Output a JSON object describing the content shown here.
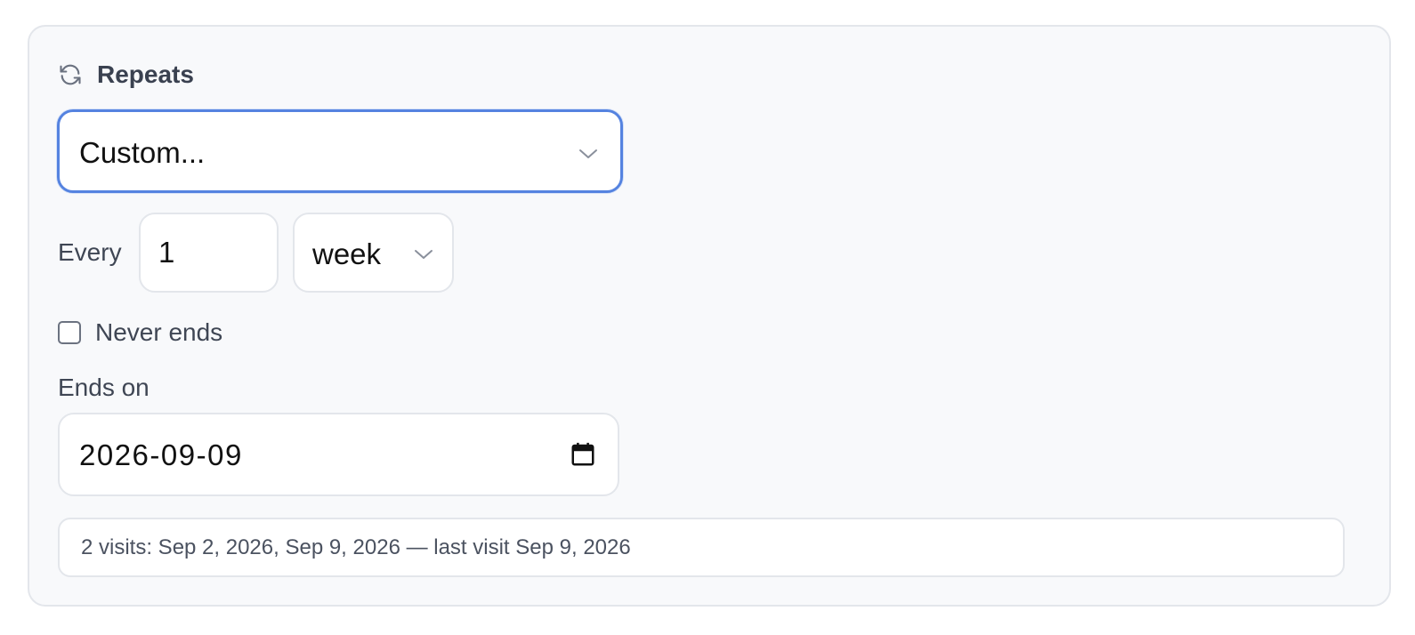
{
  "section": {
    "title": "Repeats",
    "icon": "refresh-icon"
  },
  "repeat_select": {
    "value": "Custom..."
  },
  "interval": {
    "label": "Every",
    "count": "1",
    "unit": "week"
  },
  "never_ends": {
    "label": "Never ends",
    "checked": false
  },
  "ends_on": {
    "label": "Ends on",
    "date": "2026-09-09"
  },
  "summary": {
    "text": "2 visits: Sep 2, 2026, Sep 9, 2026 — last visit Sep 9, 2026"
  },
  "colors": {
    "focus_ring": "#5583e0",
    "panel_bg": "#f8f9fb",
    "border": "#e3e6eb"
  }
}
